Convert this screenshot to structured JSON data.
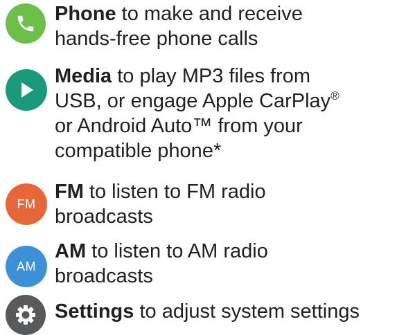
{
  "items": [
    {
      "key": "phone",
      "icon_name": "phone-icon",
      "icon_color": "#6cc04a",
      "title": "Phone",
      "line1": " to make and receive",
      "line2": "hands-free phone calls"
    },
    {
      "key": "media",
      "icon_name": "play-icon",
      "icon_color": "#1a9a7a",
      "title": "Media",
      "line1": " to play MP3 files from",
      "line2_text": "USB, or engage Apple CarPlay",
      "line2_sup": "®",
      "line3": "or Android Auto™ from your",
      "line4": "compatible phone*"
    },
    {
      "key": "fm",
      "icon_name": "fm-radio-icon",
      "icon_color": "#e8673a",
      "icon_label": "FM",
      "title": "FM",
      "line1": " to listen to FM radio",
      "line2": "broadcasts"
    },
    {
      "key": "am",
      "icon_name": "am-radio-icon",
      "icon_color": "#3d8fd6",
      "icon_label": "AM",
      "title": "AM",
      "line1": " to listen to AM radio",
      "line2": "broadcasts"
    },
    {
      "key": "settings",
      "icon_name": "gear-icon",
      "icon_color": "#58595b",
      "title": "Settings",
      "line1": " to adjust system settings"
    }
  ]
}
